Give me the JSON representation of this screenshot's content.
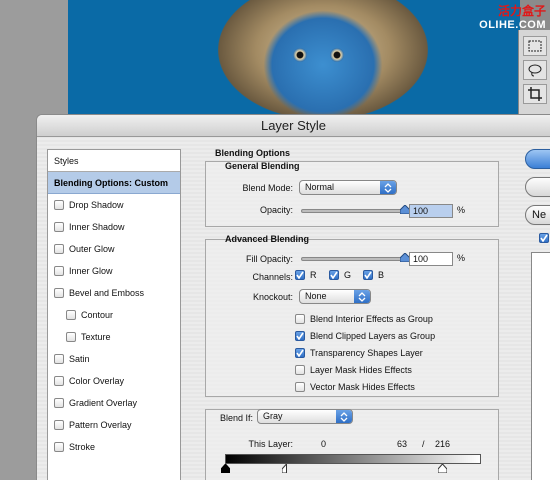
{
  "watermark": {
    "line1": "活力盒子",
    "line2": "OLIHE.COM"
  },
  "dialog": {
    "title": "Layer Style"
  },
  "styles_panel": {
    "header": "Styles",
    "items": [
      {
        "label": "Blending Options: Custom",
        "checkbox": false,
        "active": true
      },
      {
        "label": "Drop Shadow",
        "checkbox": true
      },
      {
        "label": "Inner Shadow",
        "checkbox": true
      },
      {
        "label": "Outer Glow",
        "checkbox": true
      },
      {
        "label": "Inner Glow",
        "checkbox": true
      },
      {
        "label": "Bevel and Emboss",
        "checkbox": true
      },
      {
        "label": "Contour",
        "checkbox": true,
        "indent": true
      },
      {
        "label": "Texture",
        "checkbox": true,
        "indent": true
      },
      {
        "label": "Satin",
        "checkbox": true
      },
      {
        "label": "Color Overlay",
        "checkbox": true
      },
      {
        "label": "Gradient Overlay",
        "checkbox": true
      },
      {
        "label": "Pattern Overlay",
        "checkbox": true
      },
      {
        "label": "Stroke",
        "checkbox": true
      }
    ]
  },
  "blending": {
    "title": "Blending Options",
    "general": {
      "title": "General Blending",
      "blend_mode_label": "Blend Mode:",
      "blend_mode_value": "Normal",
      "opacity_label": "Opacity:",
      "opacity_value": "100",
      "opacity_unit": "%",
      "opacity_level": 1.0
    },
    "advanced": {
      "title": "Advanced Blending",
      "fill_opacity_label": "Fill Opacity:",
      "fill_opacity_value": "100",
      "fill_opacity_unit": "%",
      "fill_opacity_level": 1.0,
      "channels_label": "Channels:",
      "channels": [
        {
          "label": "R",
          "checked": true
        },
        {
          "label": "G",
          "checked": true
        },
        {
          "label": "B",
          "checked": true
        }
      ],
      "knockout_label": "Knockout:",
      "knockout_value": "None",
      "options": [
        {
          "label": "Blend Interior Effects as Group",
          "checked": false
        },
        {
          "label": "Blend Clipped Layers as Group",
          "checked": true
        },
        {
          "label": "Transparency Shapes Layer",
          "checked": true
        },
        {
          "label": "Layer Mask Hides Effects",
          "checked": false
        },
        {
          "label": "Vector Mask Hides Effects",
          "checked": false
        }
      ]
    },
    "blend_if": {
      "label": "Blend If:",
      "value": "Gray",
      "this_layer_label": "This Layer:",
      "low_value": "0",
      "mid_value": "63",
      "separator": "/",
      "high_value": "216"
    }
  },
  "buttons": {
    "new_partial": "Ne"
  },
  "colors": {
    "accent": "#3b7fd6",
    "canvas": "#0a6aa6",
    "active_row": "#b4cbe8"
  }
}
